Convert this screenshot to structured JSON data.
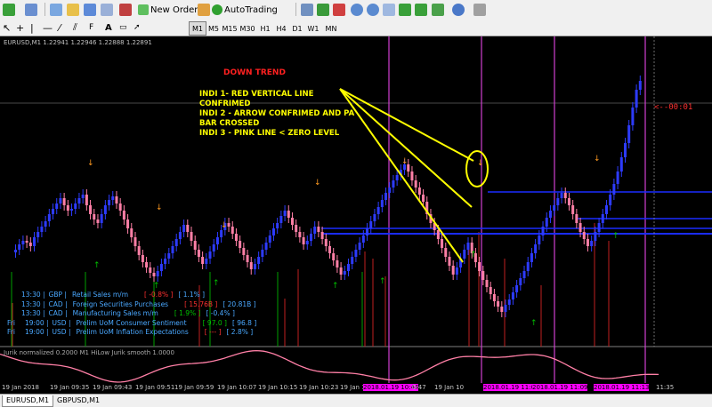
{
  "toolbar": {
    "new_order_label": "New Order",
    "autotrading_label": "AutoTrading"
  },
  "timeframes": [
    "M1",
    "M5",
    "M15",
    "M30",
    "H1",
    "H4",
    "D1",
    "W1",
    "MN"
  ],
  "active_timeframe": "M1",
  "chart": {
    "header": "EURUSD,M1  1.22941 1.22946 1.22888 1.22891",
    "trend_title": "DOWN TREND",
    "indi_lines": [
      "INDI 1- RED VERTICAL LINE",
      "CONFRIMED",
      "INDI 2 - ARROW CONFRIMED AND PA",
      "BAR CROSSED",
      "INDI 3 - PINK LINE < ZERO LEVEL"
    ],
    "countdown": "<--00:01",
    "oscillator_label": "Jurik normalized 0.2000 M1 HiLow Jurik smooth 1.0000"
  },
  "news": [
    {
      "time": "13:30",
      "cur": "GBP",
      "event": "Retail Sales m/m",
      "actual": "[ -0.8% ]",
      "forecast": "[ 1.1% ]",
      "actual_color": "#ff3030"
    },
    {
      "time": "13:30",
      "cur": "CAD",
      "event": "Foreign Securities Purchases",
      "actual": "[ 15.76B ]",
      "forecast": "[ 20.81B ]",
      "actual_color": "#ff3030"
    },
    {
      "time": "13:30",
      "cur": "CAD",
      "event": "Manufacturing Sales m/m",
      "actual": "[ 1.9% ]",
      "forecast": "[ -0.4% ]",
      "actual_color": "#00c000"
    },
    {
      "day": "Fri",
      "time": "19:00",
      "cur": "USD",
      "event": "Prelim UoM Consumer Sentiment",
      "actual": "[ 97.0 ]",
      "forecast": "[ 96.8 ]",
      "actual_color": "#00c000"
    },
    {
      "day": "Fri",
      "time": "19:00",
      "cur": "USD",
      "event": "Prelim UoM Inflation Expectations",
      "actual": "[ --- ]",
      "forecast": "[ 2.8% ]",
      "actual_color": "#ff3030"
    }
  ],
  "time_axis": [
    {
      "label": "19 Jan 2018",
      "hl": false
    },
    {
      "label": "19 Jan 09:35",
      "hl": false
    },
    {
      "label": "19 Jan 09:43",
      "hl": false
    },
    {
      "label": "19 Jan 09:51",
      "hl": false
    },
    {
      "label": "19 Jan 09:59",
      "hl": false
    },
    {
      "label": "19 Jan 10:07",
      "hl": false
    },
    {
      "label": "19 Jan 10:15",
      "hl": false
    },
    {
      "label": "19 Jan 10:23",
      "hl": false
    },
    {
      "label": "19 Jan 10:31",
      "hl": false
    },
    {
      "label": "2018.01.19 10:46",
      "hl": true
    },
    {
      "label": "0:47",
      "hl": false
    },
    {
      "label": "19 Jan 10",
      "hl": false
    },
    {
      "label": "2018.01.19 11:05",
      "hl": true
    },
    {
      "label": "2018.01.19 11:09",
      "hl": true
    },
    {
      "label": "2018.01.19 11:13",
      "hl": true
    },
    {
      "label": "11:35",
      "hl": false
    }
  ],
  "tabs": [
    "EURUSD,M1",
    "GBPUSD,M1"
  ],
  "colors": {
    "bull": "#2d3bff",
    "bear": "#ff7fa6",
    "magenta_line": "#d040d0",
    "annotation": "#ffff00",
    "level_blue": "#1a2cff"
  },
  "icons": [
    "new-chart-icon",
    "profiles-icon",
    "crosshair-icon",
    "zoom-in-icon",
    "zoom-out-icon",
    "tile-icon",
    "autotrading-icon",
    "clock-icon"
  ]
}
